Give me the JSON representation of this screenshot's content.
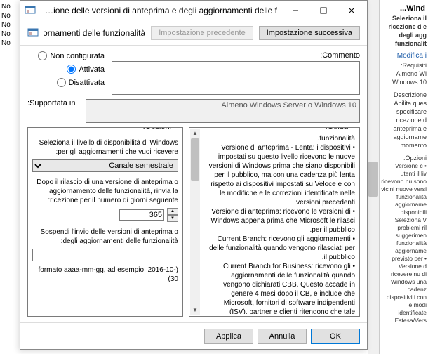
{
  "background": {
    "header": "Wind...",
    "policy_title": "Seleziona il\nricezione d\ne degli agg\nfunzionalit",
    "edit_link": "Modifica i",
    "req_label": "Requisiti:",
    "req_text": "Almeno Wi\nWindows 10",
    "desc_label": "Descrizione",
    "desc_text": "Abilita ques specificare ricezione d anteprima e aggiorname momento...",
    "opt_label": "Opzioni:",
    "opt_text": "• Versione c utenti il liv ricevono nu sono vicini nuove versi funzionalità aggiorname disponibili Seleziona V problemi ril suggerimen funzionalità aggiorname previsto per • Versione d ricevere nu di Windows una cadenz dispositivi i con le modi identificate Estesa/Vers",
    "left_col": [
      "No",
      "No",
      "No",
      "No",
      "No"
    ],
    "bottom": "Estesa  Standard"
  },
  "dialog": {
    "title": "Seleziona il momento per la ricezione delle versioni di anteprima e degli aggiornamenti delle f…",
    "subtitle": "Seleziona il momento per la ricezione delle versioni di anteprima e degli aggiornamenti delle funzionalità",
    "nav_prev": "Impostazione precedente",
    "nav_next": "Impostazione successiva",
    "radio_none": "Non configurata",
    "radio_enabled": "Attivata",
    "radio_disabled": "Disattivata",
    "comment_label": "Commento:",
    "supported_label": "Supportata in:",
    "supported_text": "Almeno Windows Server o Windows 10",
    "options_label": "Opzioni:",
    "help_label": "Guida:",
    "opt1_text": "Seleziona il livello di disponibilità di Windows per gli aggiornamenti che vuoi ricevere:",
    "combo_value": "Canale semestrale",
    "opt2_text": "Dopo il rilascio di una versione di anteprima o aggiornamento delle funzionalità, rinvia la ricezione per il numero di giorni seguente:",
    "spinner_value": "365",
    "opt3_text": "Sospendi l'invio delle versioni di anteprima o degli aggiornamenti delle funzionalità:",
    "textfield_value": "",
    "opt4_text": "(formato aaaa-mm-gg, ad esempio: 2016-10-30)",
    "help_text": "funzionalità.\n• Versione di anteprima - Lenta: i dispositivi impostati su questo livello ricevono le nuove versioni di Windows prima che siano disponibili per il pubblico, ma con una cadenza più lenta rispetto ai dispositivi impostati su Veloce e con le modifiche e le correzioni identificate nelle versioni precedenti.\n• Versione di anteprima: ricevono le versioni di Windows appena prima che Microsoft le rilasci per il pubblico.\n• Current Branch: ricevono gli aggiornamenti delle funzionalità quando vengono rilasciati per il pubblico.\n• Current Branch for Business: ricevono gli aggiornamenti delle funzionalità quando vengono dichiarati CBB. Questo accade in genere 4 mesi dopo il CB, e include che Microsoft, fornitori di software indipendenti (ISV), partner e clienti ritengono che tale versione sia pronta per l'ampia distribuzione.\n\nQuando selezioni una versione di anteprima:\n- Puoi rinviare la ricezione delle versioni di anteprima per un",
    "btn_ok": "OK",
    "btn_cancel": "Annulla",
    "btn_apply": "Applica"
  }
}
